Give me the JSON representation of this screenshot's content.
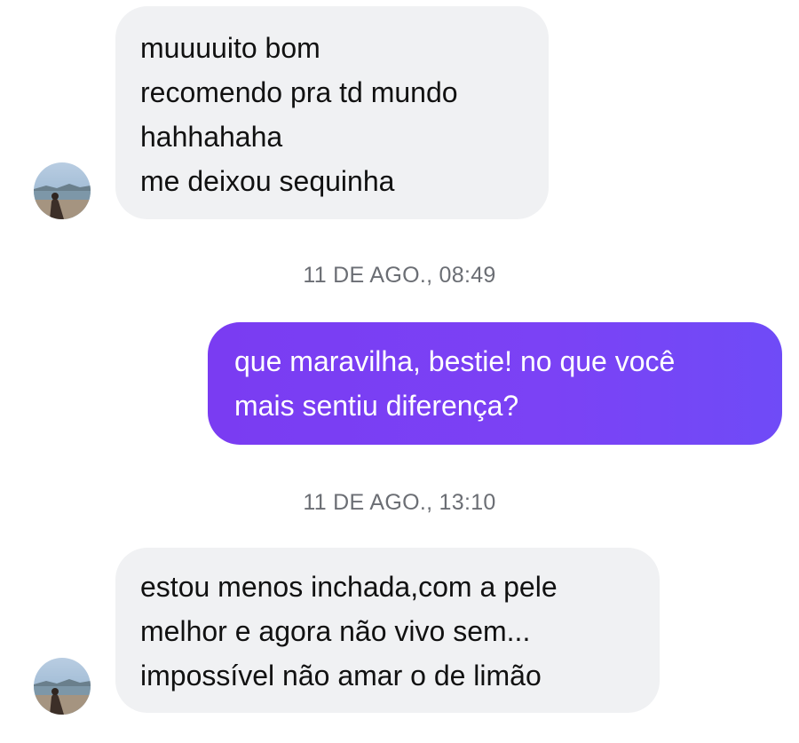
{
  "messages": [
    {
      "direction": "incoming",
      "lines": [
        "muuuuito bom",
        "recomendo pra td mundo",
        "hahhahaha",
        "me deixou sequinha"
      ]
    },
    {
      "direction": "outgoing",
      "timestamp": "11 DE AGO., 08:49",
      "lines": [
        "que maravilha, bestie! no que você",
        "mais sentiu diferença?"
      ]
    },
    {
      "direction": "incoming",
      "timestamp": "11 DE AGO., 13:10",
      "lines": [
        "estou menos inchada,com a pele",
        "melhor e agora não vivo sem...",
        "impossível não amar o de limão"
      ]
    }
  ],
  "icons": {
    "contact_avatar": "avatar-beach-icon"
  },
  "colors": {
    "incoming_bubble": "#f0f1f3",
    "outgoing_bubble": "#7a3cf2",
    "timestamp_text": "#6b6e74"
  }
}
